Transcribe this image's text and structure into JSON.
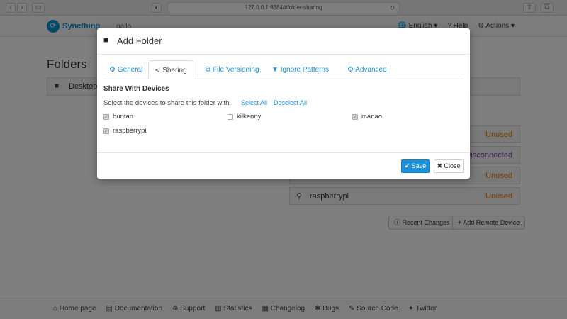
{
  "browser": {
    "url": "127.0.0.1:8384/#folder-sharing",
    "back_icon": "chevron-left",
    "forward_icon": "chevron-right",
    "reload_icon": "reload"
  },
  "navbar": {
    "brand": "Syncthing",
    "device_name": "gallo",
    "language": "English",
    "help": "Help",
    "actions": "Actions"
  },
  "page": {
    "title": "Folders",
    "folder_label": "Desktop"
  },
  "remote_devices": [
    {
      "name": "",
      "status": "Unused",
      "status_color": "#e67e00"
    },
    {
      "name": "",
      "status": "Disconnected",
      "status_color": "#8e3fb5"
    },
    {
      "name": "",
      "status": "Unused",
      "status_color": "#e67e00"
    },
    {
      "name": "raspberrypi",
      "status": "Unused",
      "status_color": "#e67e00"
    }
  ],
  "buttons": {
    "recent_changes": "Recent Changes",
    "add_remote_device": "+ Add Remote Device"
  },
  "footer": {
    "links": [
      "Home page",
      "Documentation",
      "Support",
      "Statistics",
      "Changelog",
      "Bugs",
      "Source Code",
      "Twitter"
    ]
  },
  "modal": {
    "title": "Add Folder",
    "tabs": [
      "General",
      "Sharing",
      "File Versioning",
      "Ignore Patterns",
      "Advanced"
    ],
    "active_tab": "Sharing",
    "share_heading": "Share With Devices",
    "share_description": "Select the devices to share this folder with.",
    "select_all": "Select All",
    "deselect_all": "Deselect All",
    "devices": [
      {
        "name": "buntan",
        "checked": true
      },
      {
        "name": "kilkenny",
        "checked": false
      },
      {
        "name": "manao",
        "checked": true
      },
      {
        "name": "raspberrypi",
        "checked": true
      }
    ],
    "save_label": "Save",
    "close_label": "Close"
  }
}
